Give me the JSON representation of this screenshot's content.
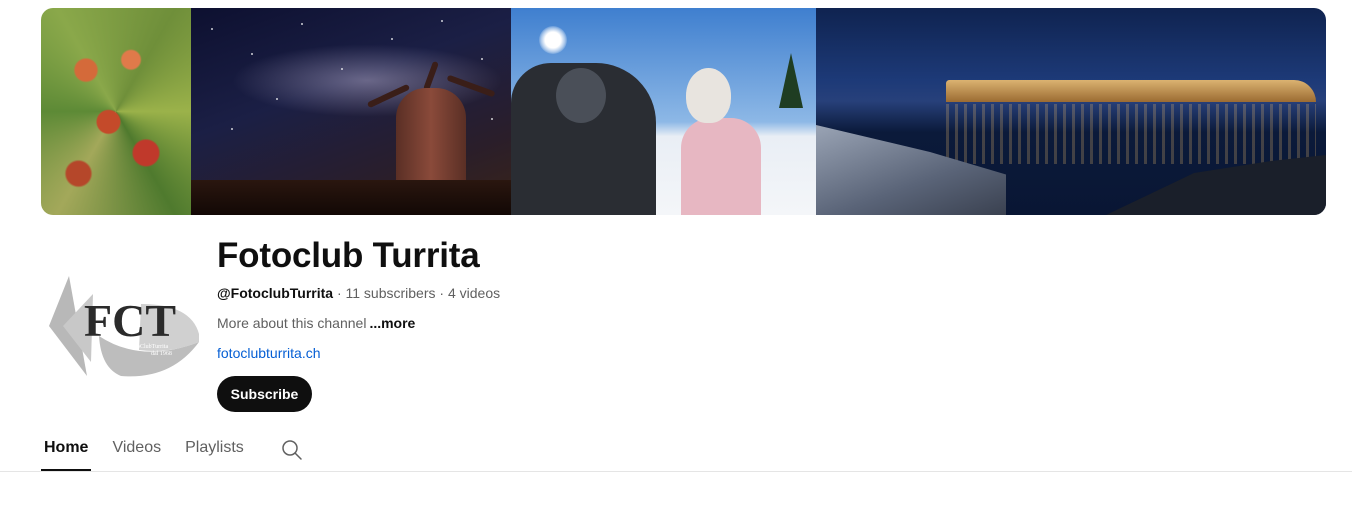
{
  "channel": {
    "name": "Fotoclub Turrita",
    "handle": "@FotoclubTurrita",
    "subscribers": "11 subscribers",
    "videos": "4 videos",
    "separator": "·",
    "description": "More about this channel",
    "more_label": "...more",
    "link": "fotoclubturrita.ch"
  },
  "avatar": {
    "logo_text": "FCT",
    "logo_subtext_1": "FotoClubTurrita",
    "logo_subtext_2": "dal 1968"
  },
  "subscribe_label": "Subscribe",
  "tabs": [
    {
      "label": "Home",
      "active": true
    },
    {
      "label": "Videos",
      "active": false
    },
    {
      "label": "Playlists",
      "active": false
    }
  ],
  "icons": {
    "search": "search-icon"
  },
  "colors": {
    "subscribe_bg": "#0f0f0f",
    "link": "#065fd4",
    "secondary_text": "#606060"
  }
}
